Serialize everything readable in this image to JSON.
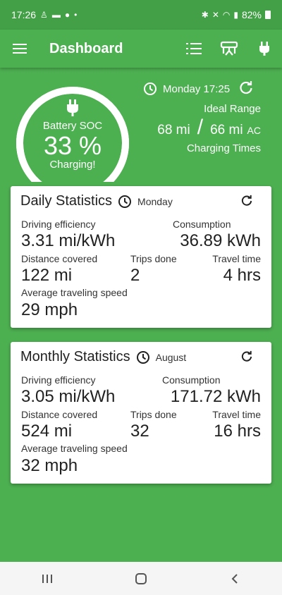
{
  "status_bar": {
    "time": "17:26",
    "battery": "82%"
  },
  "app_bar": {
    "title": "Dashboard"
  },
  "hero": {
    "soc_label": "Battery SOC",
    "soc_value": "33 %",
    "soc_fraction": 0.33,
    "charge_state": "Charging!",
    "datetime": "Monday 17:25",
    "ideal_range_label": "Ideal Range",
    "range_a": "68 mi",
    "range_sep": "/",
    "range_b": "66 mi",
    "range_b_suffix": "AC",
    "charging_times": "Charging Times"
  },
  "daily": {
    "title": "Daily Statistics",
    "day": "Monday",
    "efficiency_label": "Driving efficiency",
    "efficiency": "3.31 mi/kWh",
    "consumption_label": "Consumption",
    "consumption": "36.89 kWh",
    "distance_label": "Distance covered",
    "distance": "122 mi",
    "trips_label": "Trips done",
    "trips": "2",
    "travel_label": "Travel time",
    "travel": "4 hrs",
    "speed_label": "Average traveling speed",
    "speed": "29 mph"
  },
  "monthly": {
    "title": "Monthly Statistics",
    "month": "August",
    "efficiency_label": "Driving efficiency",
    "efficiency": "3.05 mi/kWh",
    "consumption_label": "Consumption",
    "consumption": "171.72 kWh",
    "distance_label": "Distance covered",
    "distance": "524 mi",
    "trips_label": "Trips done",
    "trips": "32",
    "travel_label": "Travel time",
    "travel": "16 hrs",
    "speed_label": "Average traveling speed",
    "speed": "32 mph"
  },
  "colors": {
    "primary": "#4caf50",
    "status": "#43a047",
    "card": "#ffffff"
  },
  "icons": [
    "menu-icon",
    "list-icon",
    "charger-icon",
    "plug-icon",
    "clock-icon",
    "refresh-icon"
  ]
}
